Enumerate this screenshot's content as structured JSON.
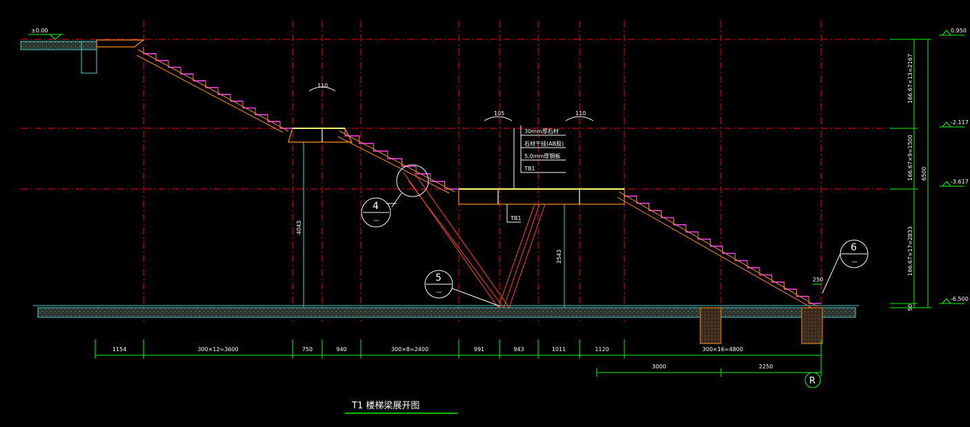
{
  "drawing_title": "T1  楼梯梁展开图",
  "colors": {
    "background": "#000000",
    "grid": "#ff0000",
    "dimension": "#00ff00",
    "ground": "#4fd0d0",
    "structure": "#ff8c1a",
    "tread": "#ff44ff",
    "text": "#ffffff"
  },
  "elevations": {
    "left_top": "±0.00",
    "right": [
      "0.950",
      "-2.117",
      "-3.617",
      "-6.500"
    ]
  },
  "vertical_dims": [
    "166.67×13=2167",
    "166.67×9=1500",
    "166.67×17=2833",
    "50"
  ],
  "overall_height": "6500",
  "bottom_dims": [
    "1154",
    "300×12=3600",
    "750",
    "940",
    "300×8=2400",
    "991",
    "943",
    "1011",
    "1120",
    "300×16=4800"
  ],
  "lower_dims": [
    "3000",
    "2250"
  ],
  "post_heights": [
    "4043",
    "2543"
  ],
  "angles": [
    "110",
    "105",
    "110"
  ],
  "spacing_250": "250",
  "callouts": [
    {
      "num": "4",
      "sub": "—"
    },
    {
      "num": "5",
      "sub": "—"
    },
    {
      "num": "6",
      "sub": "—"
    }
  ],
  "notes": [
    "30mm厚石材",
    "石材干挂(AB胶)",
    "5.0mm厚钢板",
    "TB1"
  ],
  "beam_tag": "TB1",
  "axis_label": "R"
}
